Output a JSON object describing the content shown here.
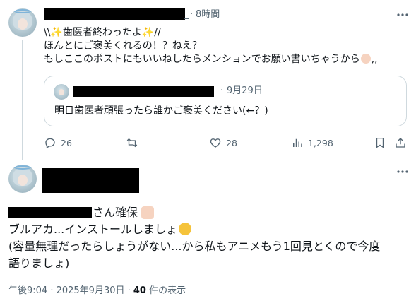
{
  "tweet1": {
    "time": "8時間",
    "separator": "·",
    "lines": [
      "\\\\✨歯医者終わったよ✨//",
      "ほんとにご褒美くれるの！？ねえ？",
      "もしここのポストにもいいねしたらメンションでお願い書いちゃうから"
    ],
    "line3_tail": ",,",
    "quote": {
      "date": "9月29日",
      "separator": "·",
      "text": "明日歯医者頑張ったら誰かご褒美ください(←？)"
    },
    "actions": {
      "reply_count": "26",
      "retweet_count": "",
      "like_count": "28",
      "views_count": "1,298"
    }
  },
  "tweet2": {
    "mention_suffix": "さん確保",
    "line2": "ブルアカ...インストールしましょ",
    "line3": "(容量無理だったらしょうがない...から私もアニメもう1回見とくので今度",
    "line4": "語りましょ)",
    "meta_time": "午後9:04 · 2025年9月30日 · ",
    "views_num": "40",
    "views_label": " 件の表示"
  },
  "colors": {
    "muted": "#536471",
    "border": "#cfd9de",
    "link": "#1d9bf0"
  }
}
